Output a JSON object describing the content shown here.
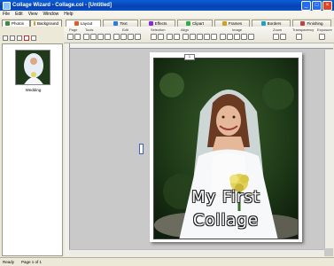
{
  "titlebar": {
    "title": "Collage Wizard - Collage.col - [Untitled]"
  },
  "menu": [
    "File",
    "Edit",
    "View",
    "Window",
    "Help"
  ],
  "left_tabs": [
    "Photos",
    "Background"
  ],
  "top_tabs": [
    "Layout",
    "Text",
    "Effects",
    "Clipart",
    "Frames",
    "Borders",
    "Finishing"
  ],
  "ribbon_groups": [
    "Page",
    "Tools",
    "Edit",
    "Selection",
    "Align",
    "Image",
    "Zoom",
    "Transparency",
    "Exposure"
  ],
  "thumbnail": {
    "label": "Wedding"
  },
  "canvas": {
    "caption_line1": "My First",
    "caption_line2": "Collage",
    "frame_tag": "1"
  },
  "status": {
    "left": "Ready",
    "right": "Page 1 of 1"
  },
  "colors": {
    "title_bar": "#0842b0",
    "workspace": "#c9c9c9",
    "accent_close": "#d9472b"
  }
}
